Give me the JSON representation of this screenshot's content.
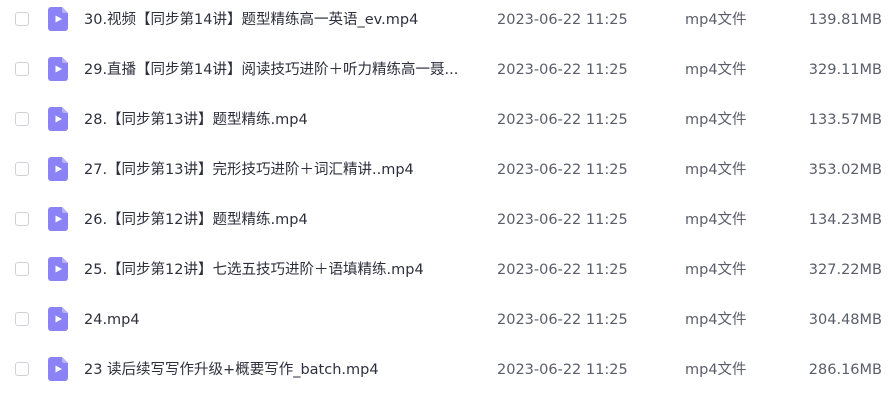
{
  "file_icon": {
    "name": "video-file-icon",
    "color": "#8b83f5",
    "accent": "#ffffff"
  },
  "files": [
    {
      "name": "30.视频【同步第14讲】题型精练高一英语_ev.mp4",
      "date": "2023-06-22 11:25",
      "type": "mp4文件",
      "size": "139.81MB"
    },
    {
      "name": "29.直播【同步第14讲】阅读技巧进阶＋听力精练高一聂...",
      "date": "2023-06-22 11:25",
      "type": "mp4文件",
      "size": "329.11MB"
    },
    {
      "name": "28.【同步第13讲】题型精练.mp4",
      "date": "2023-06-22 11:25",
      "type": "mp4文件",
      "size": "133.57MB"
    },
    {
      "name": "27.【同步第13讲】完形技巧进阶＋词汇精讲..mp4",
      "date": "2023-06-22 11:25",
      "type": "mp4文件",
      "size": "353.02MB"
    },
    {
      "name": "26.【同步第12讲】题型精练.mp4",
      "date": "2023-06-22 11:25",
      "type": "mp4文件",
      "size": "134.23MB"
    },
    {
      "name": "25.【同步第12讲】七选五技巧进阶＋语填精练.mp4",
      "date": "2023-06-22 11:25",
      "type": "mp4文件",
      "size": "327.22MB"
    },
    {
      "name": "24.mp4",
      "date": "2023-06-22 11:25",
      "type": "mp4文件",
      "size": "304.48MB"
    },
    {
      "name": "23 读后续写写作升级+概要写作_batch.mp4",
      "date": "2023-06-22 11:25",
      "type": "mp4文件",
      "size": "286.16MB"
    }
  ]
}
